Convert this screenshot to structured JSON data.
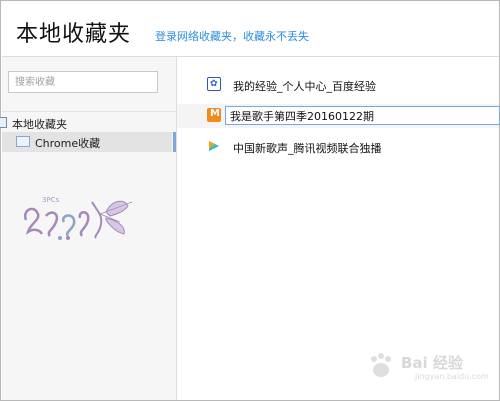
{
  "header": {
    "title": "本地收藏夹",
    "login_link": "登录网络收藏夹，收藏永不丢失"
  },
  "sidebar": {
    "search_placeholder": "搜索收藏",
    "root_label": "本地收藏夹",
    "child_label": "Chrome收藏",
    "logo_text": "3PCs"
  },
  "bookmarks": [
    {
      "title": "我的经验_个人中心_百度经验",
      "icon": "baidu-paw-icon"
    },
    {
      "title": "我是歌手第四季20160122期",
      "icon": "mango-tv-icon",
      "editing": true
    },
    {
      "title": "中国新歌声_腾讯视频联合独播",
      "icon": "tencent-video-icon"
    }
  ],
  "watermark": {
    "text": "Bai 经验",
    "sub": "jingyan.baidu.com"
  },
  "colors": {
    "link": "#2d8ee0",
    "selection": "#e3e3e3",
    "edit_border": "#7aa7dd"
  }
}
